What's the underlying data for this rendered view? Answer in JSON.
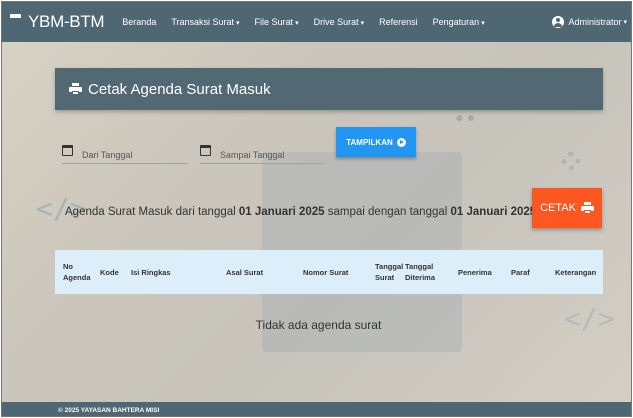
{
  "navbar": {
    "brand": "YBM-BTM",
    "items": [
      {
        "label": "Beranda",
        "dropdown": false
      },
      {
        "label": "Transaksi Surat",
        "dropdown": true
      },
      {
        "label": "File Surat",
        "dropdown": true
      },
      {
        "label": "Drive Surat",
        "dropdown": true
      },
      {
        "label": "Referensi",
        "dropdown": false
      },
      {
        "label": "Pengaturan",
        "dropdown": true
      }
    ],
    "caret": "▾",
    "user": "Administrator",
    "color": "#4f6773"
  },
  "card": {
    "title": "Cetak Agenda Surat Masuk",
    "icon": "printer-icon"
  },
  "form": {
    "from_placeholder": "Dari Tanggal",
    "to_placeholder": "Sampai Tanggal",
    "show_button": "TAMPILKAN"
  },
  "agenda": {
    "prefix": "Agenda Surat Masuk dari tanggal ",
    "from_date": "01 Januari 2025",
    "middle": " sampai dengan tanggal ",
    "to_date": "01 Januari 2025",
    "print_button": "CETAK"
  },
  "table": {
    "columns": [
      {
        "label": "No\nAgenda"
      },
      {
        "label": "Kode"
      },
      {
        "label": "Isi Ringkas"
      },
      {
        "label": "Asal Surat"
      },
      {
        "label": "Nomor Surat"
      },
      {
        "label": "Tanggal\nSurat"
      },
      {
        "label": "Tanggal\nDiterima"
      },
      {
        "label": "Penerima"
      },
      {
        "label": "Paraf"
      },
      {
        "label": "Keterangan"
      }
    ],
    "empty_message": "Tidak ada agenda surat"
  },
  "footer": {
    "text": "© 2025 YAYASAN BAHTERA MISI"
  },
  "colors": {
    "primary": "#2196f3",
    "accent": "#ff5722",
    "header": "#526872",
    "table_head": "#dbeefa"
  }
}
